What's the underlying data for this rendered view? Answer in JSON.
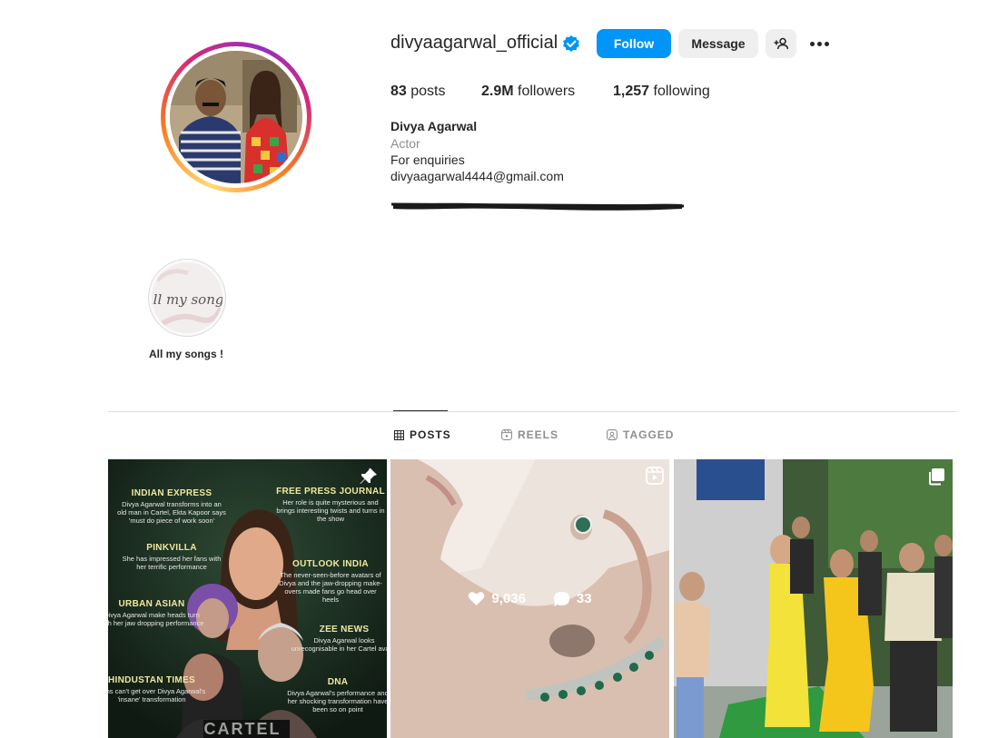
{
  "profile": {
    "username": "divyaagarwal_official",
    "verified": true,
    "follow_label": "Follow",
    "message_label": "Message",
    "stats": {
      "posts_value": "83",
      "posts_label": "posts",
      "followers_value": "2.9M",
      "followers_label": "followers",
      "following_value": "1,257",
      "following_label": "following"
    },
    "bio": {
      "name": "Divya Agarwal",
      "category": "Actor",
      "line1": "For enquiries",
      "email": "divyaagarwal4444@gmail.com"
    }
  },
  "highlights": [
    {
      "label": "All my songs !",
      "cover_text": "All my songs"
    }
  ],
  "tabs": [
    {
      "label": "POSTS",
      "icon": "grid-icon",
      "active": true
    },
    {
      "label": "REELS",
      "icon": "reels-icon",
      "active": false
    },
    {
      "label": "TAGGED",
      "icon": "tagged-icon",
      "active": false
    }
  ],
  "posts": [
    {
      "type": "pinned",
      "icon": "pin-icon",
      "left_items": [
        {
          "head": "INDIAN EXPRESS",
          "body": "Divya Agarwal transforms into an old man in Cartel, Ekta Kapoor says 'must do piece of work soon'"
        },
        {
          "head": "PINKVILLA",
          "body": "She has impressed her fans with her terrific performance"
        },
        {
          "head": "URBAN ASIAN",
          "body": "Divya Agarwal make heads turn with her jaw dropping performance"
        },
        {
          "head": "HINDUSTAN TIMES",
          "body": "Fans can't get over Divya Agarwal's 'insane' transformation"
        }
      ],
      "right_items": [
        {
          "head": "FREE PRESS JOURNAL",
          "body": "Her role is quite mysterious and brings interesting twists and turns in the show"
        },
        {
          "head": "OUTLOOK INDIA",
          "body": "The never-seen-before avatars of Divya and the jaw-dropping make-overs made fans go head over heels"
        },
        {
          "head": "ZEE NEWS",
          "body": "Divya Agarwal looks unrecognisable in her Cartel avatar"
        },
        {
          "head": "DNA",
          "body": "Divya Agarwal's performance and her shocking transformation have been so on point"
        }
      ],
      "bottom_title": "CARTEL"
    },
    {
      "type": "reel",
      "icon": "reels-icon",
      "likes": "9,036",
      "comments": "33"
    },
    {
      "type": "carousel",
      "icon": "carousel-icon"
    }
  ],
  "colors": {
    "accent": "#0095f6",
    "secondary_button": "#efefef",
    "muted_text": "#8e8e8e",
    "verified_badge": "#0095f6"
  }
}
